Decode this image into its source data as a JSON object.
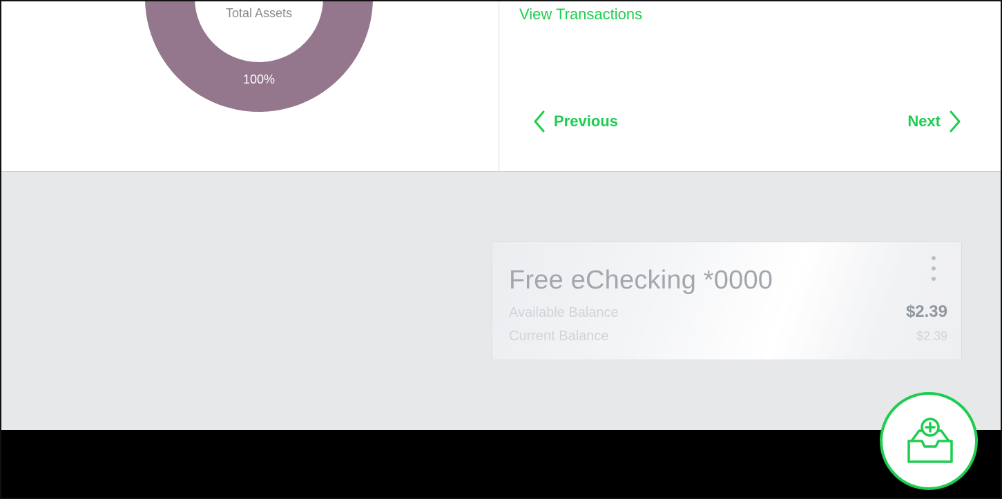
{
  "summary": {
    "chart_center_label": "Total Assets",
    "chart_slice_percent": "100%",
    "chart_color": "#94768d"
  },
  "transactions": {
    "view_label": "View Transactions",
    "previous_label": "Previous",
    "next_label": "Next",
    "accent_color": "#1ecd4f"
  },
  "account": {
    "name": "Free eChecking *0000",
    "available_label": "Available Balance",
    "available_value": "$2.39",
    "current_label": "Current Balance",
    "current_value": "$2.39"
  },
  "fab": {
    "icon": "inbox-plus-icon"
  }
}
